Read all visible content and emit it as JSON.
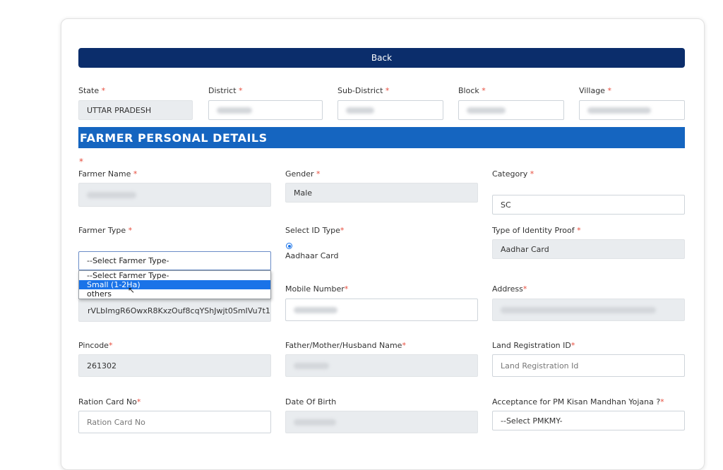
{
  "back_button": "Back",
  "location": {
    "state": {
      "label": "State",
      "value": "UTTAR PRADESH"
    },
    "district": {
      "label": "District"
    },
    "sub_district": {
      "label": "Sub-District"
    },
    "block": {
      "label": "Block"
    },
    "village": {
      "label": "Village"
    }
  },
  "required_mark": "*",
  "section_title": "FARMER PERSONAL DETAILS",
  "fields": {
    "farmer_name": {
      "label": "Farmer Name"
    },
    "gender": {
      "label": "Gender",
      "value": "Male"
    },
    "category": {
      "label": "Category",
      "value": "SC"
    },
    "farmer_type": {
      "label": "Farmer Type",
      "selected": "--Select Farmer Type-",
      "options": [
        "--Select Farmer Type-",
        "Small (1-2Ha)",
        "others"
      ],
      "highlighted_index": 1
    },
    "id_type": {
      "label": "Select ID Type",
      "option": "Aadhaar Card",
      "checked": true
    },
    "identity_proof": {
      "label": "Type of Identity Proof",
      "value": "Aadhar Card"
    },
    "aadhaar_token": {
      "value": "rVLbImgR6OwxR8KxzOuf8cqYShJwjt0SmIVu7t1"
    },
    "mobile": {
      "label": "Mobile Number"
    },
    "address": {
      "label": "Address"
    },
    "pincode": {
      "label": "Pincode",
      "value": "261302"
    },
    "relative_name": {
      "label": "Father/Mother/Husband Name"
    },
    "land_reg": {
      "label": "Land Registration ID",
      "placeholder": "Land Registration Id"
    },
    "ration_card": {
      "label": "Ration Card No",
      "placeholder": "Ration Card No"
    },
    "dob": {
      "label": "Date Of Birth"
    },
    "pmkmy": {
      "label": "Acceptance for PM Kisan Mandhan Yojana ?",
      "selected": "--Select PMKMY-"
    }
  },
  "colors": {
    "back_button": "#0b2d6b",
    "section_bar": "#1565c0",
    "required": "#e74c3c",
    "option_highlight": "#1a73e8"
  },
  "icons": {
    "cursor": "mouse-pointer-icon",
    "radio": "radio-checked-icon"
  }
}
